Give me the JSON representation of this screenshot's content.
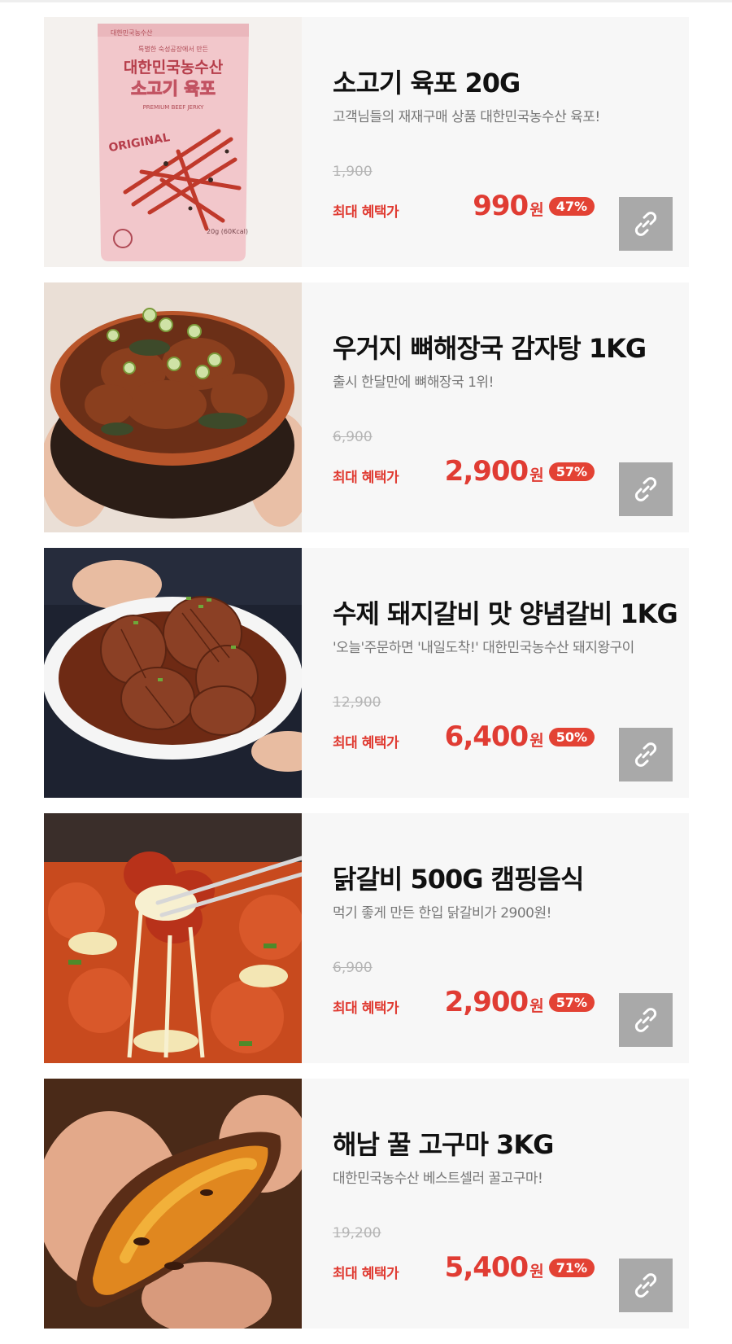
{
  "colors": {
    "accent": "#e03c33",
    "badge": "#e34234",
    "share_bg": "#a9a9a9",
    "card_bg": "#f7f7f7"
  },
  "products": [
    {
      "image_icon": "beef-jerky-package",
      "pkg_brand": "대한민국농수산",
      "pkg_tagline": "특별한 숙성공장에서 만든",
      "pkg_brand_large": "대한민국농수산",
      "pkg_product": "소고기 육포",
      "pkg_premium": "PREMIUM BEEF JERKY",
      "pkg_original": "ORIGINAL",
      "pkg_weight": "20g (60Kcal)",
      "title": "소고기 육포 20G",
      "desc": "고객님들의 재재구매 상품 대한민국농수산 육포!",
      "original_price": "1,900",
      "benefit_label": "최대 혜택가",
      "price": "990",
      "currency": "원",
      "discount": "47%",
      "share_icon": "link-icon"
    },
    {
      "image_icon": "pork-bone-soup-bowl",
      "title": "우거지 뼈해장국 감자탕 1KG",
      "desc": "출시 한달만에 뼈해장국 1위!",
      "original_price": "6,900",
      "benefit_label": "최대 혜택가",
      "price": "2,900",
      "currency": "원",
      "discount": "57%",
      "share_icon": "link-icon"
    },
    {
      "image_icon": "marinated-pork-ribs-plate",
      "title": "수제 돼지갈비 맛 양념갈비 1KG",
      "desc": "'오늘'주문하면 '내일도착!' 대한민국농수산 돼지왕구이",
      "original_price": "12,900",
      "benefit_label": "최대 혜택가",
      "price": "6,400",
      "currency": "원",
      "discount": "50%",
      "share_icon": "link-icon"
    },
    {
      "image_icon": "cheese-dakgalbi-chopsticks",
      "title": "닭갈비 500G 캠핑음식",
      "desc": "먹기 좋게 만든 한입 닭갈비가 2900원!",
      "original_price": "6,900",
      "benefit_label": "최대 혜택가",
      "price": "2,900",
      "currency": "원",
      "discount": "57%",
      "share_icon": "link-icon"
    },
    {
      "image_icon": "roasted-sweet-potato-hands",
      "title": "해남 꿀 고구마 3KG",
      "desc": "대한민국농수산 베스트셀러 꿀고구마!",
      "original_price": "19,200",
      "benefit_label": "최대 혜택가",
      "price": "5,400",
      "currency": "원",
      "discount": "71%",
      "share_icon": "link-icon"
    }
  ]
}
